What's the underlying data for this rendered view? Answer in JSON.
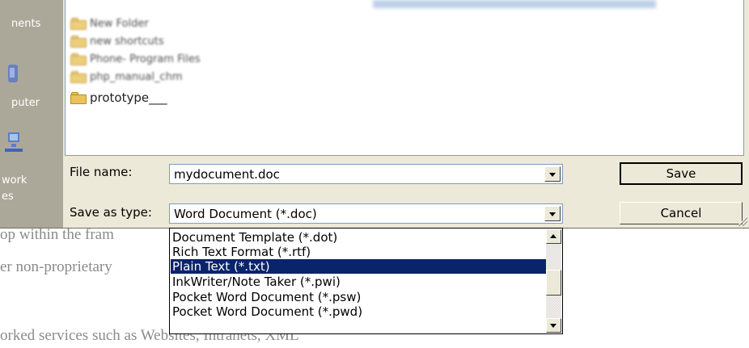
{
  "places": {
    "items": [
      "nents",
      "puter",
      "work",
      "es"
    ]
  },
  "file_list": {
    "items": [
      {
        "label": "New Folder"
      },
      {
        "label": "new shortcuts"
      },
      {
        "label": "Phone- Program Files"
      },
      {
        "label": "php_manual_chm"
      },
      {
        "label": "prototype___"
      }
    ]
  },
  "form": {
    "filename_label": "File name:",
    "filename_value": "mydocument.doc",
    "savetype_label": "Save as type:",
    "savetype_value": "Word Document (*.doc)"
  },
  "buttons": {
    "save": "Save",
    "cancel": "Cancel"
  },
  "dropdown": {
    "options": [
      "Document Template (*.dot)",
      "Rich Text Format (*.rtf)",
      "Plain Text (*.txt)",
      "InkWriter/Note Taker (*.pwi)",
      "Pocket Word Document (*.psw)",
      "Pocket Word Document (*.pwd)"
    ],
    "selected": "Plain Text (*.txt)"
  },
  "background_document": {
    "lines": [
      "op within the fram",
      "er non-proprietary",
      "orked services such as Websites, Intranets, XML"
    ]
  },
  "colors": {
    "dialog_bg": "#ece9d8",
    "selection": "#0a246a",
    "input_border": "#7f9db9"
  }
}
